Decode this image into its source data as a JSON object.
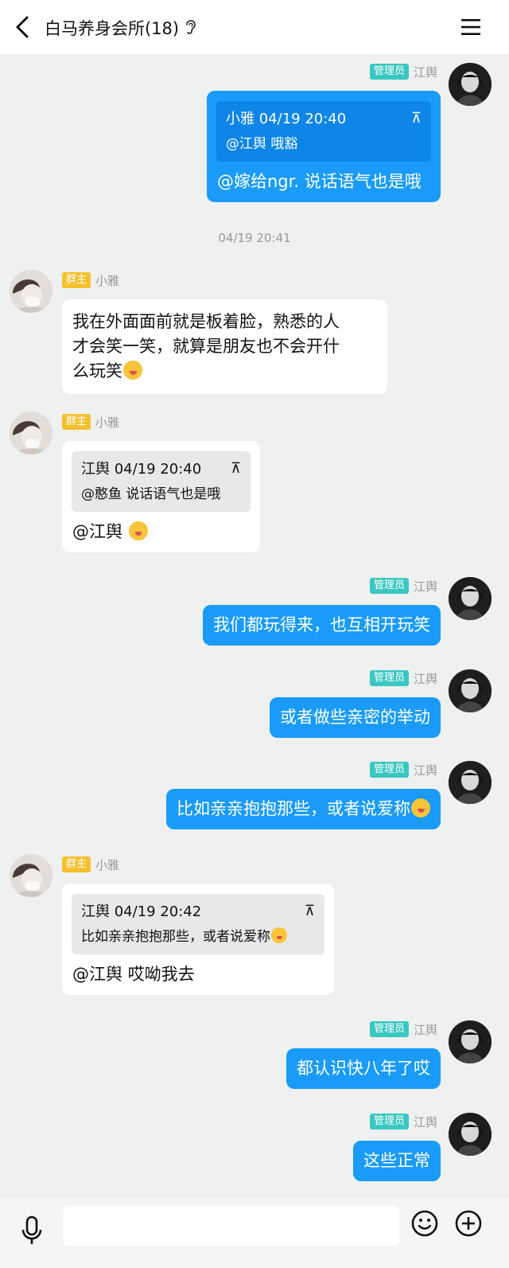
{
  "header": {
    "title": "白马养身会所(18)"
  },
  "input": {
    "placeholder": ""
  },
  "colors": {
    "admin_badge": "#3ac7c1",
    "owner_badge": "#f5c030",
    "my_bubble": "#1a9bf9",
    "background": "#eef1ef"
  },
  "messages": [
    {
      "badge": "管理员",
      "sender": "江舆",
      "quote_head": "小雅 04/19 20:40",
      "quote_body": "@江舆 哦豁",
      "text": "@嫁给ngr. 说话语气也是哦"
    },
    {
      "badge": "群主",
      "sender": "小雅",
      "lines": [
        "我在外面面前就是板着脸，熟悉的人",
        "才会笑一笑，就算是朋友也不会开什",
        "么玩笑"
      ]
    },
    {
      "badge": "群主",
      "sender": "小雅",
      "quote_head": "江舆 04/19 20:40",
      "quote_body": "@憨鱼 说话语气也是哦",
      "text": "@江舆"
    },
    {
      "badge": "管理员",
      "sender": "江舆",
      "text": "我们都玩得来，也互相开玩笑"
    },
    {
      "badge": "管理员",
      "sender": "江舆",
      "text": "或者做些亲密的举动"
    },
    {
      "badge": "管理员",
      "sender": "江舆",
      "text": "比如亲亲抱抱那些，或者说爱称"
    },
    {
      "badge": "群主",
      "sender": "小雅",
      "quote_head": "江舆 04/19 20:42",
      "quote_body": "比如亲亲抱抱那些，或者说爱称",
      "text": "@江舆 哎呦我去"
    },
    {
      "badge": "管理员",
      "sender": "江舆",
      "text": "都认识快八年了哎"
    },
    {
      "badge": "管理员",
      "sender": "江舆",
      "text": "这些正常"
    }
  ],
  "timestamp": "04/19 20:41",
  "icons": {
    "pin": "⊼",
    "back": "back-arrow-icon",
    "menu": "menu-icon",
    "ear": "ear-icon",
    "mic": "microphone-icon",
    "emoji": "emoji-icon",
    "plus": "plus-icon"
  }
}
